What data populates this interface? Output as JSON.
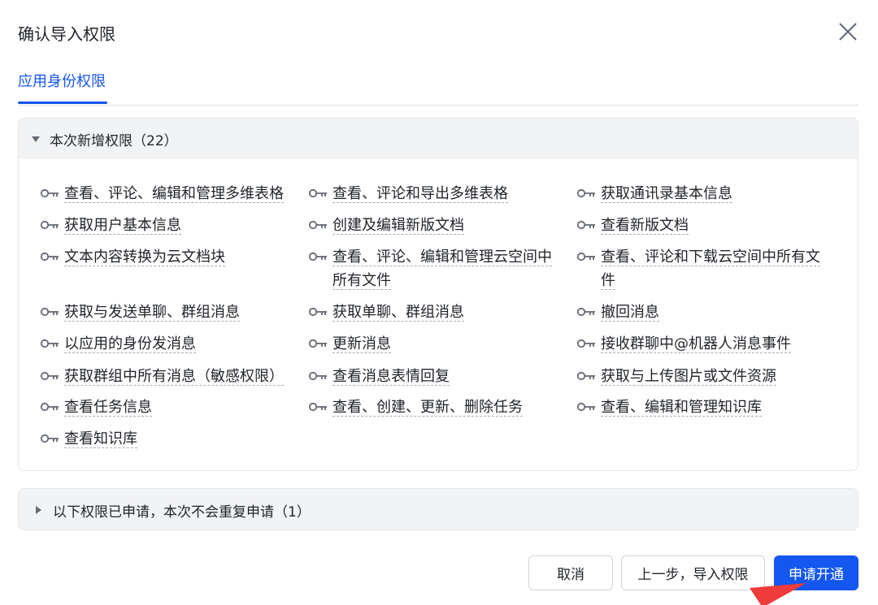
{
  "dialog": {
    "title": "确认导入权限"
  },
  "tabs": [
    {
      "label": "应用身份权限",
      "active": true
    }
  ],
  "new_permissions": {
    "header": "本次新增权限（22）",
    "expanded": true,
    "items": [
      "查看、评论、编辑和管理多维表格",
      "查看、评论和导出多维表格",
      "获取通讯录基本信息",
      "获取用户基本信息",
      "创建及编辑新版文档",
      "查看新版文档",
      "文本内容转换为云文档块",
      "查看、评论、编辑和管理云空间中所有文件",
      "查看、评论和下载云空间中所有文件",
      "获取与发送单聊、群组消息",
      "获取单聊、群组消息",
      "撤回消息",
      "以应用的身份发消息",
      "更新消息",
      "接收群聊中@机器人消息事件",
      "获取群组中所有消息（敏感权限）",
      "查看消息表情回复",
      "获取与上传图片或文件资源",
      "查看任务信息",
      "查看、创建、更新、删除任务",
      "查看、编辑和管理知识库",
      "查看知识库"
    ]
  },
  "applied_permissions": {
    "header": "以下权限已申请，本次不会重复申请（1）",
    "expanded": false
  },
  "buttons": {
    "cancel": "取消",
    "previous": "上一步，导入权限",
    "apply": "申请开通"
  },
  "colors": {
    "accent": "#1456f0",
    "panel_header_bg": "#f2f3f5",
    "text": "#1f2329"
  }
}
